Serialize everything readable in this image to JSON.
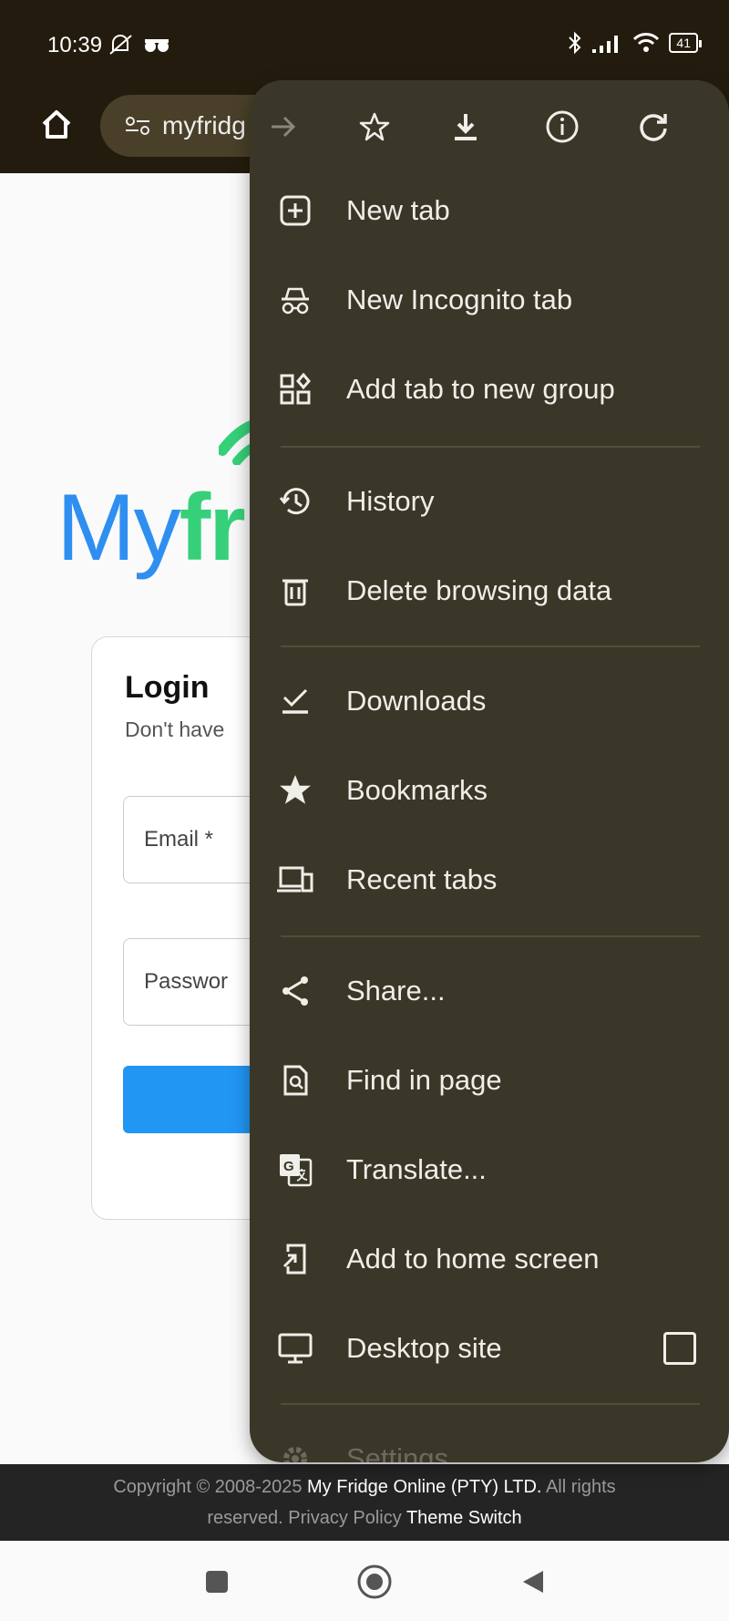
{
  "status_bar": {
    "time": "10:39",
    "battery": "41"
  },
  "toolbar": {
    "url": "myfridg"
  },
  "page": {
    "logo_my": "My",
    "logo_fr": "fr",
    "login": {
      "title": "Login",
      "subtitle": "Don't have",
      "email_placeholder": "Email *",
      "password_placeholder": "Passwor"
    },
    "footer": {
      "copyright": "Copyright © 2008-2025",
      "company": "My Fridge Online (PTY) LTD.",
      "rights_1": "All rights",
      "rights_2": "reserved.",
      "privacy": "Privacy Policy",
      "theme": "Theme Switch"
    }
  },
  "menu": {
    "top_icons": [
      "forward-icon",
      "bookmark-star-icon",
      "download-icon",
      "info-icon",
      "refresh-icon"
    ],
    "items": [
      {
        "label": "New tab",
        "icon": "new-tab-icon"
      },
      {
        "label": "New Incognito tab",
        "icon": "incognito-icon"
      },
      {
        "label": "Add tab to new group",
        "icon": "tab-group-icon"
      },
      {
        "label": "History",
        "icon": "history-icon"
      },
      {
        "label": "Delete browsing data",
        "icon": "trash-icon"
      },
      {
        "label": "Downloads",
        "icon": "downloads-icon"
      },
      {
        "label": "Bookmarks",
        "icon": "bookmarks-star-icon"
      },
      {
        "label": "Recent tabs",
        "icon": "recent-tabs-icon"
      },
      {
        "label": "Share...",
        "icon": "share-icon"
      },
      {
        "label": "Find in page",
        "icon": "find-in-page-icon"
      },
      {
        "label": "Translate...",
        "icon": "translate-icon"
      },
      {
        "label": "Add to home screen",
        "icon": "add-to-home-icon"
      },
      {
        "label": "Desktop site",
        "icon": "desktop-icon",
        "checked": false
      },
      {
        "label": "Settings",
        "icon": "settings-gear-icon"
      }
    ]
  },
  "colors": {
    "menu_bg": "#3a3728",
    "toolbar_bg": "#231c0e",
    "logo_blue": "#2f8ff0",
    "logo_green": "#36d07a",
    "button_blue": "#2196f3"
  }
}
